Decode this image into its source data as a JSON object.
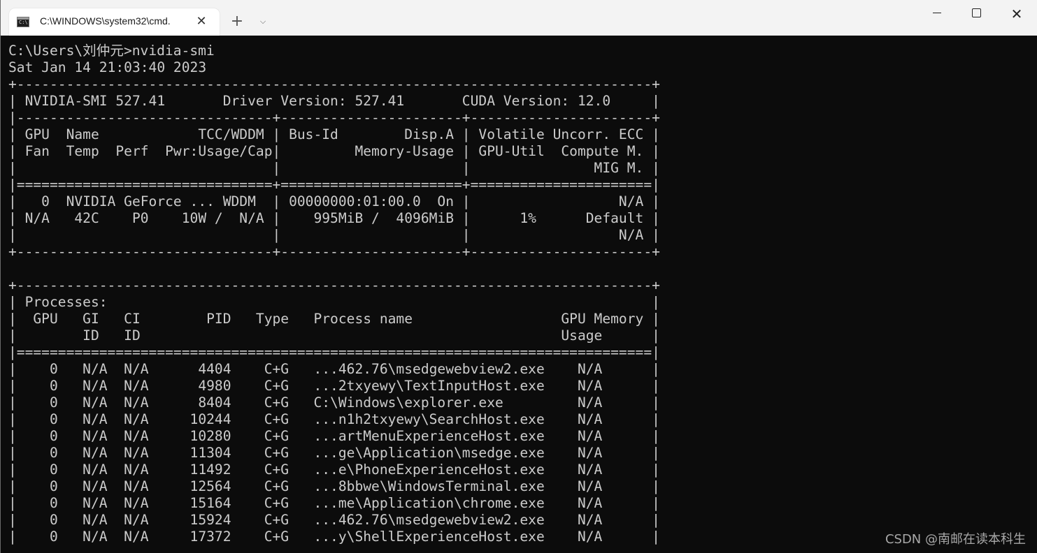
{
  "window": {
    "tab_title": "C:\\WINDOWS\\system32\\cmd.",
    "tab_icon_glyph": "C:\\",
    "close_tab_glyph": "✕",
    "new_tab_glyph": "+",
    "dropdown_glyph": "⌵",
    "close_window_glyph": "✕"
  },
  "terminal": {
    "lines": [
      "C:\\Users\\刘仲元>nvidia-smi",
      "Sat Jan 14 21:03:40 2023",
      "+-----------------------------------------------------------------------------+",
      "| NVIDIA-SMI 527.41       Driver Version: 527.41       CUDA Version: 12.0     |",
      "|-------------------------------+----------------------+----------------------+",
      "| GPU  Name            TCC/WDDM | Bus-Id        Disp.A | Volatile Uncorr. ECC |",
      "| Fan  Temp  Perf  Pwr:Usage/Cap|         Memory-Usage | GPU-Util  Compute M. |",
      "|                               |                      |               MIG M. |",
      "|===============================+======================+======================|",
      "|   0  NVIDIA GeForce ... WDDM  | 00000000:01:00.0  On |                  N/A |",
      "| N/A   42C    P0    10W /  N/A |    995MiB /  4096MiB |      1%      Default |",
      "|                               |                      |                  N/A |",
      "+-------------------------------+----------------------+----------------------+",
      "",
      "+-----------------------------------------------------------------------------+",
      "| Processes:                                                                  |",
      "|  GPU   GI   CI        PID   Type   Process name                  GPU Memory |",
      "|        ID   ID                                                   Usage      |",
      "|=============================================================================|",
      "|    0   N/A  N/A      4404    C+G   ...462.76\\msedgewebview2.exe    N/A      |",
      "|    0   N/A  N/A      4980    C+G   ...2txyewy\\TextInputHost.exe    N/A      |",
      "|    0   N/A  N/A      8404    C+G   C:\\Windows\\explorer.exe         N/A      |",
      "|    0   N/A  N/A     10244    C+G   ...n1h2txyewy\\SearchHost.exe    N/A      |",
      "|    0   N/A  N/A     10280    C+G   ...artMenuExperienceHost.exe    N/A      |",
      "|    0   N/A  N/A     11304    C+G   ...ge\\Application\\msedge.exe    N/A      |",
      "|    0   N/A  N/A     11492    C+G   ...e\\PhoneExperienceHost.exe    N/A      |",
      "|    0   N/A  N/A     12564    C+G   ...8bbwe\\WindowsTerminal.exe    N/A      |",
      "|    0   N/A  N/A     15164    C+G   ...me\\Application\\chrome.exe    N/A      |",
      "|    0   N/A  N/A     15924    C+G   ...462.76\\msedgewebview2.exe    N/A      |",
      "|    0   N/A  N/A     17372    C+G   ...y\\ShellExperienceHost.exe    N/A      |"
    ]
  },
  "watermark": "CSDN @南邮在读本科生",
  "colors": {
    "terminal_bg": "#0c0c0c",
    "terminal_fg": "#cccccc",
    "titlebar_bg": "#f3f3f3",
    "tab_bg": "#ffffff"
  }
}
